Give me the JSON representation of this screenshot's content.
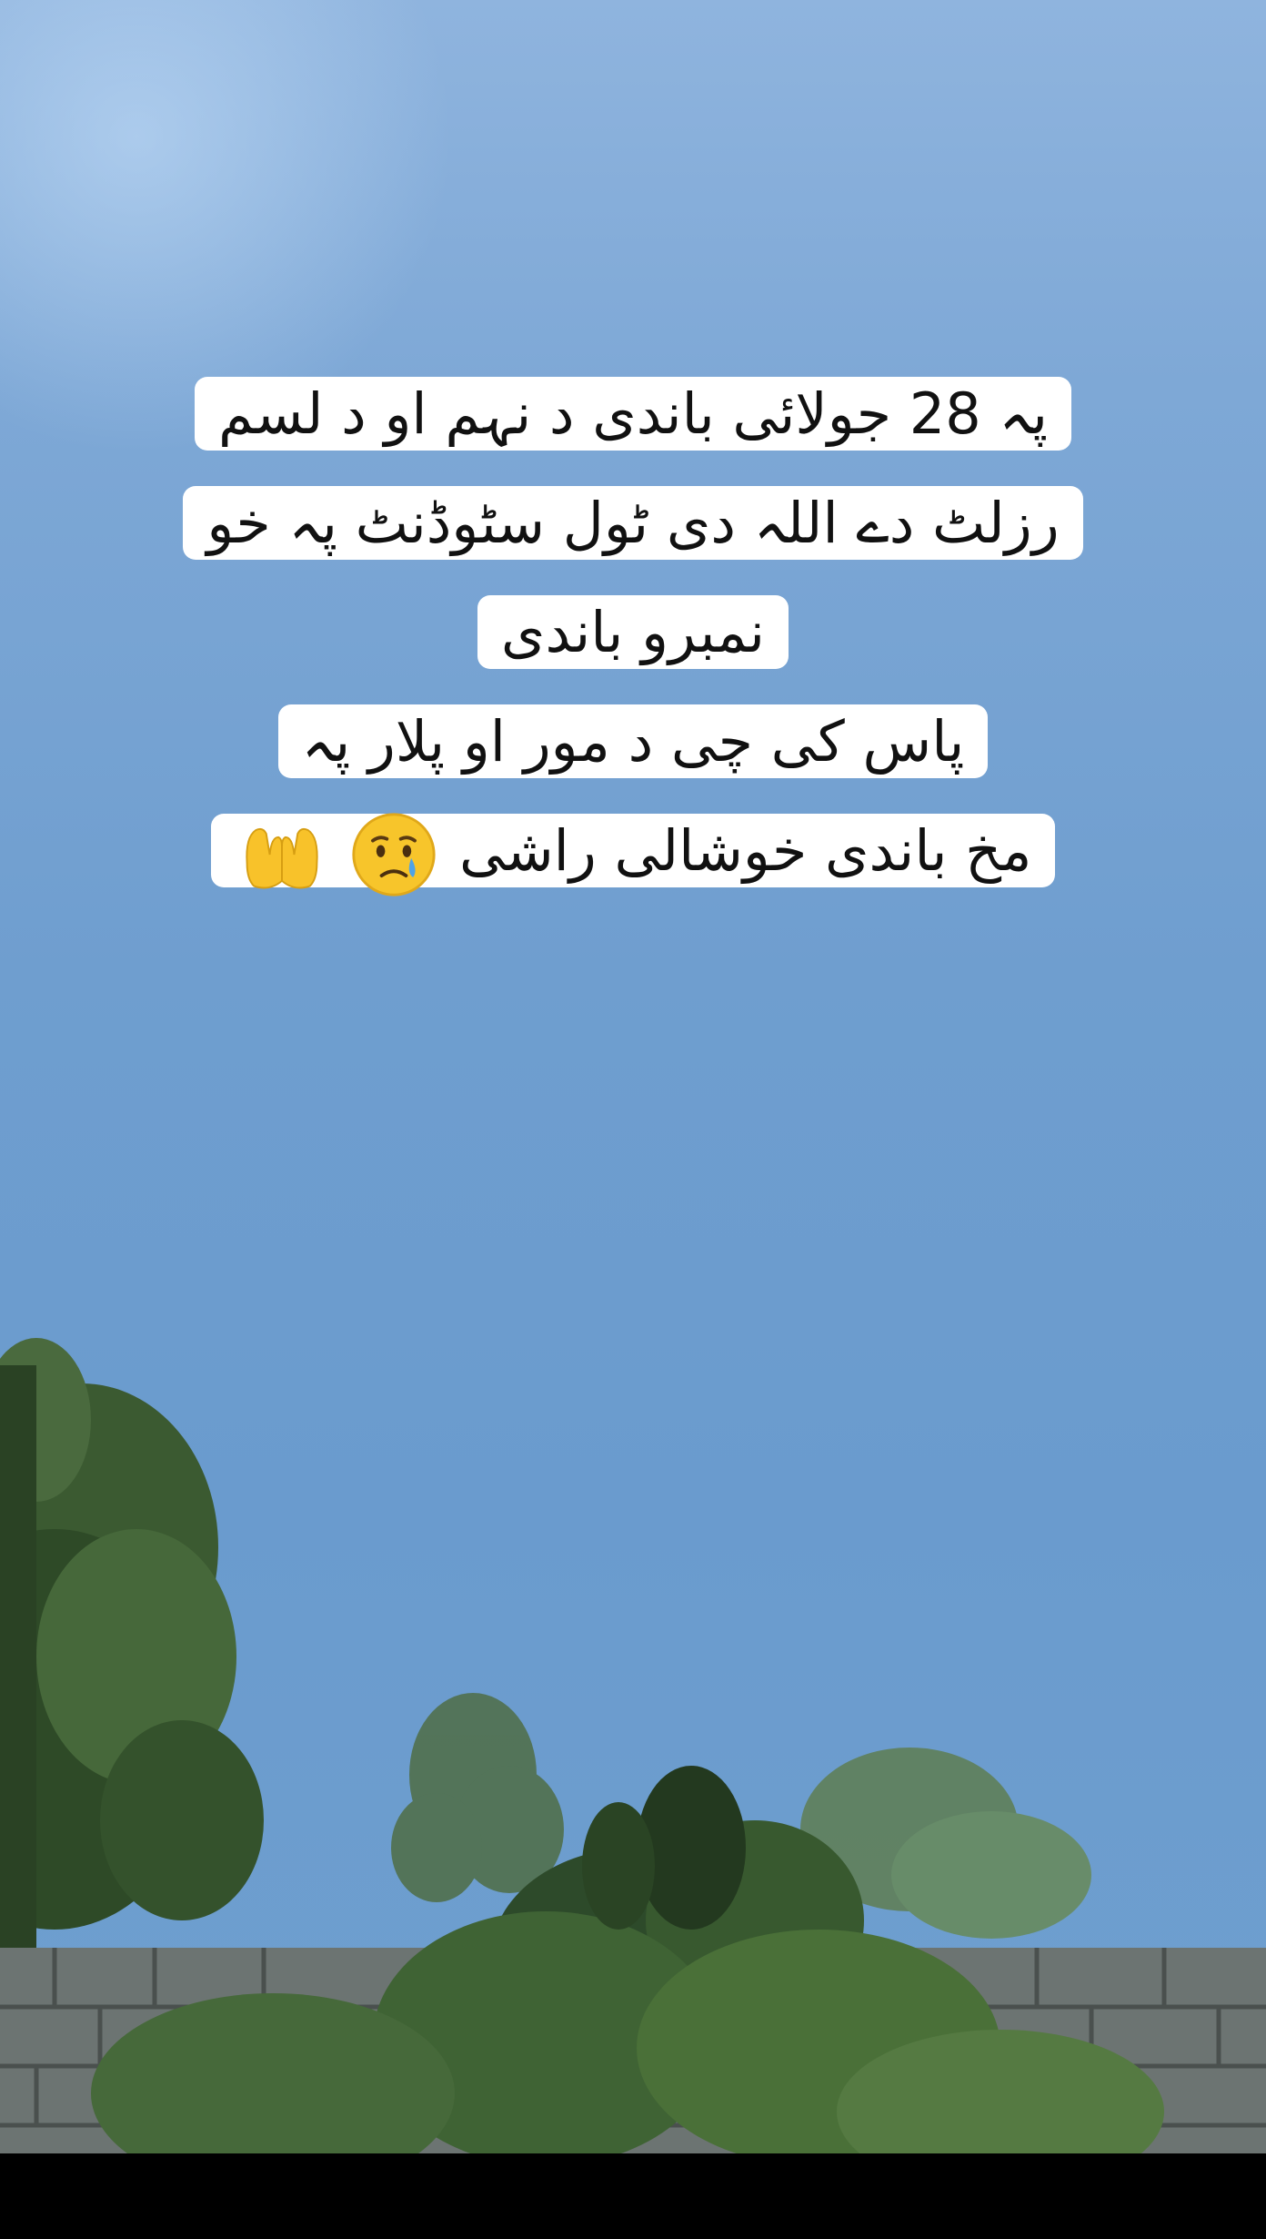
{
  "caption": {
    "lines": [
      "پہ 28 جولائی باندی د نہم او د لسم",
      "رزلٹ دے اللہ دی ٹول سٹوڈنٹ پہ خو",
      "نمبرو باندی",
      "پاس کی چی د مور او پلار پہ",
      "مخ باندی خوشالی راشی"
    ],
    "emojis": [
      "crying-face",
      "palms-up-together"
    ]
  }
}
